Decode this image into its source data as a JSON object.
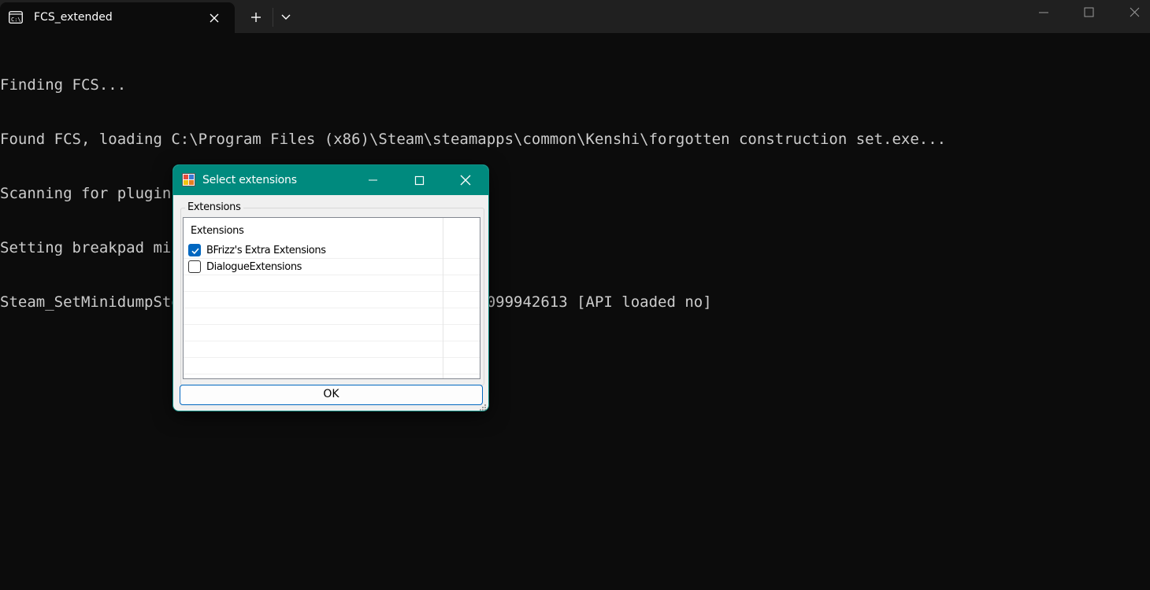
{
  "terminal": {
    "tab_title": "FCS_extended",
    "tab_icon": "console-icon",
    "controls": {
      "close_tab": "close-icon",
      "new_tab": "plus-icon",
      "dropdown": "chevron-down-icon",
      "minimize": "minimize-icon",
      "maximize": "maximize-icon",
      "close_window": "close-icon"
    }
  },
  "console": {
    "lines": [
      "Finding FCS...",
      "Found FCS, loading C:\\Program Files (x86)\\Steam\\steamapps\\common\\Kenshi\\forgotten construction set.exe...",
      "Scanning for plugins...",
      "Setting breakpad minidump AppID = 233860",
      "Steam_SetMinidumpSteamID:  Caching Steam ID:  76561198099942613 [API loaded no]"
    ]
  },
  "dialog": {
    "title": "Select extensions",
    "group_label": "Extensions",
    "list": {
      "column_header": "Extensions",
      "items": [
        {
          "label": "BFrizz's Extra Extensions",
          "checked": true
        },
        {
          "label": "DialogueExtensions",
          "checked": false
        }
      ]
    },
    "ok_label": "OK"
  },
  "colors": {
    "terminal_bg": "#0c0c0c",
    "titlebar_bg": "#202020",
    "console_text": "#cccccc",
    "dialog_title_bg": "#008a7e",
    "accent": "#0067c0"
  }
}
